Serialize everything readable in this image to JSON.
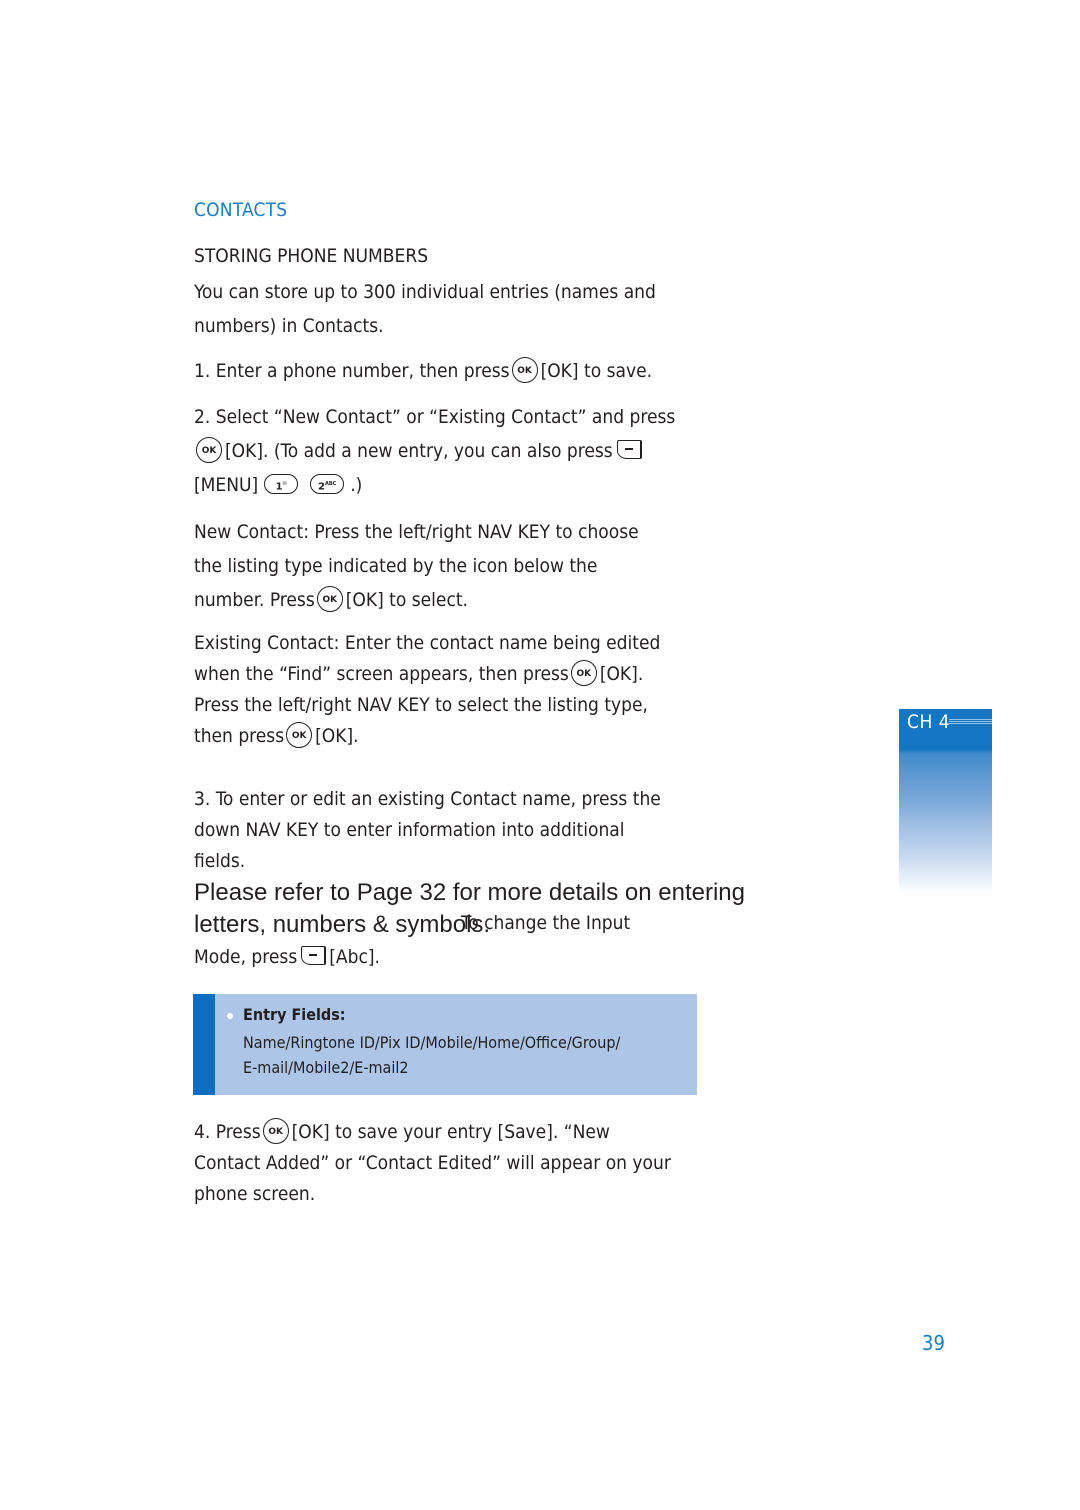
{
  "section": {
    "title": "CONTACTS",
    "subtitle": "STORING PHONE NUMBERS"
  },
  "intro": {
    "line1": "You can store up to 300 individual entries (names and",
    "line2": "numbers) in Contacts."
  },
  "step1": {
    "before": "1. Enter a phone number, then press",
    "key": "OK",
    "after": "[OK] to save."
  },
  "step2": {
    "line1": "2. Select “New Contact” or “Existing Contact” and press",
    "key": "OK",
    "line2_after": "[OK]. (To add a new entry, you can also press",
    "line3_menu": "[MENU]",
    "key_1_label": "1",
    "key_1_icon": "envelope-icon",
    "key_2_label": "2",
    "key_2_sub": "ABC",
    "line3_end": ".)"
  },
  "new_contact": {
    "line1": "New Contact: Press the left/right NAV KEY to choose",
    "line2": "the listing type indicated by the icon below the",
    "line3_before": "number. Press",
    "key": "OK",
    "line3_after": "[OK] to select."
  },
  "existing_contact": {
    "line1": "Existing Contact: Enter the contact name being edited",
    "line2_before": "when the “Find” screen appears, then press",
    "key": "OK",
    "line2_after": "[OK].",
    "line3": "Press the left/right NAV KEY to select the listing type,",
    "line4_before": "then press",
    "line4_after": "[OK]."
  },
  "step3": {
    "line1": "3. To enter or edit an existing Contact name, press the",
    "line2": "down NAV KEY to enter information into additional",
    "line3": "fields.",
    "overlay_line1": "Please refer to Page 32 for more details on entering",
    "overlay_line2": "letters, numbers & symbols.",
    "hidden_text": "To change the Input",
    "line5_before": "Mode, press",
    "line5_after": "[Abc]."
  },
  "tip": {
    "title": "Entry Fields:",
    "line1": "Name/Ringtone ID/Pix ID/Mobile/Home/Office/Group/",
    "line2": "E-mail/Mobile2/E-mail2"
  },
  "step4": {
    "line1_before": "4. Press",
    "key": "OK",
    "line1_after": "[OK] to save your entry [Save]. “New",
    "line2": "Contact Added” or “Contact Edited” will appear on your",
    "line3": "phone screen."
  },
  "chapter_tab": {
    "label": "CH 4"
  },
  "page_number": "39",
  "colors": {
    "accent": "#1b7ec2",
    "tip_background": "#adc6e8",
    "tip_bar": "#0f6dbf",
    "text": "#231f20"
  }
}
